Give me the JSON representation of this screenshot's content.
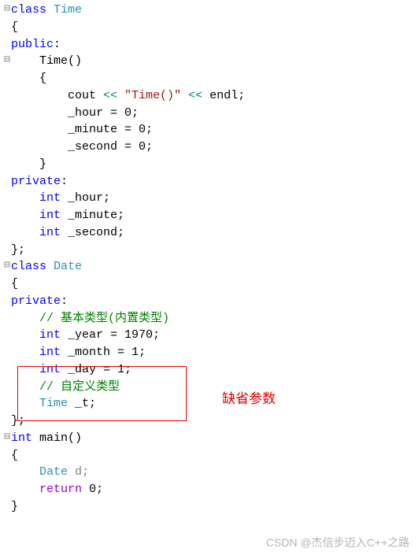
{
  "code": {
    "l1_kw_class": "class",
    "l1_type": "Time",
    "l2_brace": "{",
    "l3_access": "public",
    "l3_colon": ":",
    "l4_ctor": "Time",
    "l4_parens": "()",
    "l5_brace": "{",
    "l6_cout": "cout ",
    "l6_op1": "<<",
    "l6_str": " \"Time()\" ",
    "l6_op2": "<<",
    "l6_endl": " endl;",
    "l7_hour": "_hour = 0;",
    "l8_minute": "_minute = 0;",
    "l9_second": "_second = 0;",
    "l10_brace": "}",
    "l11_access": "private",
    "l11_colon": ":",
    "l12_int": "int",
    "l12_name": " _hour;",
    "l13_int": "int",
    "l13_name": " _minute;",
    "l14_int": "int",
    "l14_name": " _second;",
    "l15_close": "};",
    "l16_kw_class": "class",
    "l16_type": "Date",
    "l17_brace": "{",
    "l18_access": "private",
    "l18_colon": ":",
    "l19_comment": "// 基本类型(内置类型)",
    "l20_int": "int",
    "l20_name": " _year = 1970;",
    "l21_int": "int",
    "l21_name": " _month = 1;",
    "l22_int": "int",
    "l22_name": " _day = 1;",
    "l23_comment": "// 自定义类型",
    "l24_type": "Time",
    "l24_name": " _t;",
    "l25_close": "};",
    "l26_int": "int",
    "l26_main": " main",
    "l26_parens": "()",
    "l27_brace": "{",
    "l28_type": "Date",
    "l28_var": " d;",
    "l29_return": "return",
    "l29_val": " 0;",
    "l30_brace": "}"
  },
  "annotation": "缺省参数",
  "watermark": "CSDN @杰信步迈入C++之路",
  "gutter_minus": "⊟",
  "gutter_bar": " "
}
